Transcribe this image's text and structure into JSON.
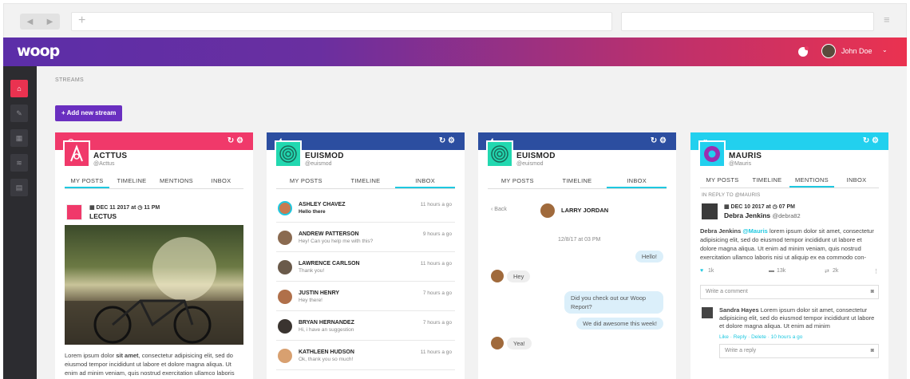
{
  "app": {
    "logo": "woop",
    "user_name": "John Doe",
    "user_caret": "⌄",
    "hamburger": "≡",
    "new_tab": "+",
    "back": "◀",
    "forward": "▶"
  },
  "icons": {
    "notification": "notification-icon",
    "avatar": "avatar",
    "home": "home-icon",
    "edit": "edit-icon",
    "calendar": "calendar-icon",
    "rss": "rss-icon",
    "chart": "chart-icon",
    "refresh": "refresh-icon",
    "settings": "gear-icon",
    "camera": "camera-icon",
    "heart": "heart-icon",
    "comment": "comment-icon",
    "retweet": "retweet-icon"
  },
  "sidebar": {
    "items": [
      "⌂",
      "✎",
      "▦",
      "≋",
      "▤"
    ]
  },
  "main": {
    "breadcrumb": "STREAMS",
    "add_stream": "+ Add new stream"
  },
  "colors": {
    "instagram": "#f0396a",
    "facebook": "#2c4ea0",
    "twitter": "#22d0ee",
    "accent": "#6a2fc0",
    "tab_active": "#1ec8e0",
    "sidebar_active": "#ea3250"
  },
  "columns": [
    {
      "network": "◎",
      "actions": "↻ ⚙",
      "name": "ACTTUS",
      "handle": "@Acttus",
      "tabs": [
        "MY POSTS",
        "TIMELINE",
        "MENTIONS",
        "INBOX"
      ],
      "post": {
        "date": "▦ DEC 11 2017 at ◷ 11 PM",
        "title": "LECTUS",
        "text_lead": "Lorem ipsum dolor ",
        "text_bold": "sit amet",
        "text_rest": ", consectetur adipisicing elit, sed do eiusmod tempor incididunt ut labore et dolore magna aliqua. Ut enim ad minim veniam, quis nostrud exercitation ullamco laboris"
      }
    },
    {
      "network": "f",
      "actions": "↻ ⚙",
      "name": "EUISMOD",
      "handle": "@euismod",
      "tabs": [
        "MY POSTS",
        "TIMELINE",
        "INBOX"
      ],
      "inbox": [
        {
          "name": "ASHLEY CHAVEZ",
          "msg": "Hello there",
          "time": "11 hours a go",
          "bold": true
        },
        {
          "name": "ANDREW PATTERSON",
          "msg": "Hey! Can you help me with this?",
          "time": "9 hours a go"
        },
        {
          "name": "LAWRENCE CARLSON",
          "msg": "Thank you!",
          "time": "11 hours a go"
        },
        {
          "name": "JUSTIN HENRY",
          "msg": "Hey there!",
          "time": "7 hours a go"
        },
        {
          "name": "BRYAN HERNANDEZ",
          "msg": "Hi, i have an suggestion",
          "time": "7 hours a go"
        },
        {
          "name": "KATHLEEN HUDSON",
          "msg": "Ok, thank you so much!",
          "time": "11 hours a go"
        }
      ]
    },
    {
      "network": "f",
      "actions": "↻ ⚙",
      "name": "EUISMOD",
      "handle": "@euismod",
      "tabs": [
        "MY POSTS",
        "TIMELINE",
        "INBOX"
      ],
      "chat": {
        "back": "‹ Back",
        "contact": "LARRY JORDAN",
        "date": "12/8/17 at 03 PM",
        "messages": [
          "Hello!",
          "Hey",
          "Did you check out our Woop Report?",
          "We did awesome this week!",
          "Yea!"
        ]
      }
    },
    {
      "network": "♥",
      "actions": "↻ ⚙",
      "name": "MAURIS",
      "handle": "@Mauris",
      "tabs": [
        "MY POSTS",
        "TIMELINE",
        "MENTIONS",
        "INBOX"
      ],
      "mention": {
        "reply_to": "IN REPLY TO @MAURIS",
        "date": "▦ DEC 10 2017 at ◷ 07 PM",
        "author": "Debra Jenkins",
        "mention": "@Mauris",
        "author_handle": "@debra82",
        "text_lead": "Debra Jenkins ",
        "text": "lorem ipsum dolor sit amet, consectetur adipisicing elit, sed do eiusmod tempor incididunt ut labore et dolore magna aliqua. Ut enim ad minim veniam, quis nostrud exercitation ullamco laboris nisi ut aliquip ex ea commodo con-",
        "likes": "1k",
        "comments": "13k",
        "retweets": "2k",
        "more": "⋮",
        "comment_placeholder": "Write a comment",
        "reply_author": "Sandra Hayes",
        "reply_text": "Lorem ipsum dolor sit amet, consectetur adipisicing elit, sed do eiusmod tempor incididunt ut labore et dolore magna aliqua. Ut enim ad minim",
        "reply_actions": "Like · Reply · Delete · 10 hours a go",
        "reply_placeholder": "Write a reply"
      }
    }
  ]
}
